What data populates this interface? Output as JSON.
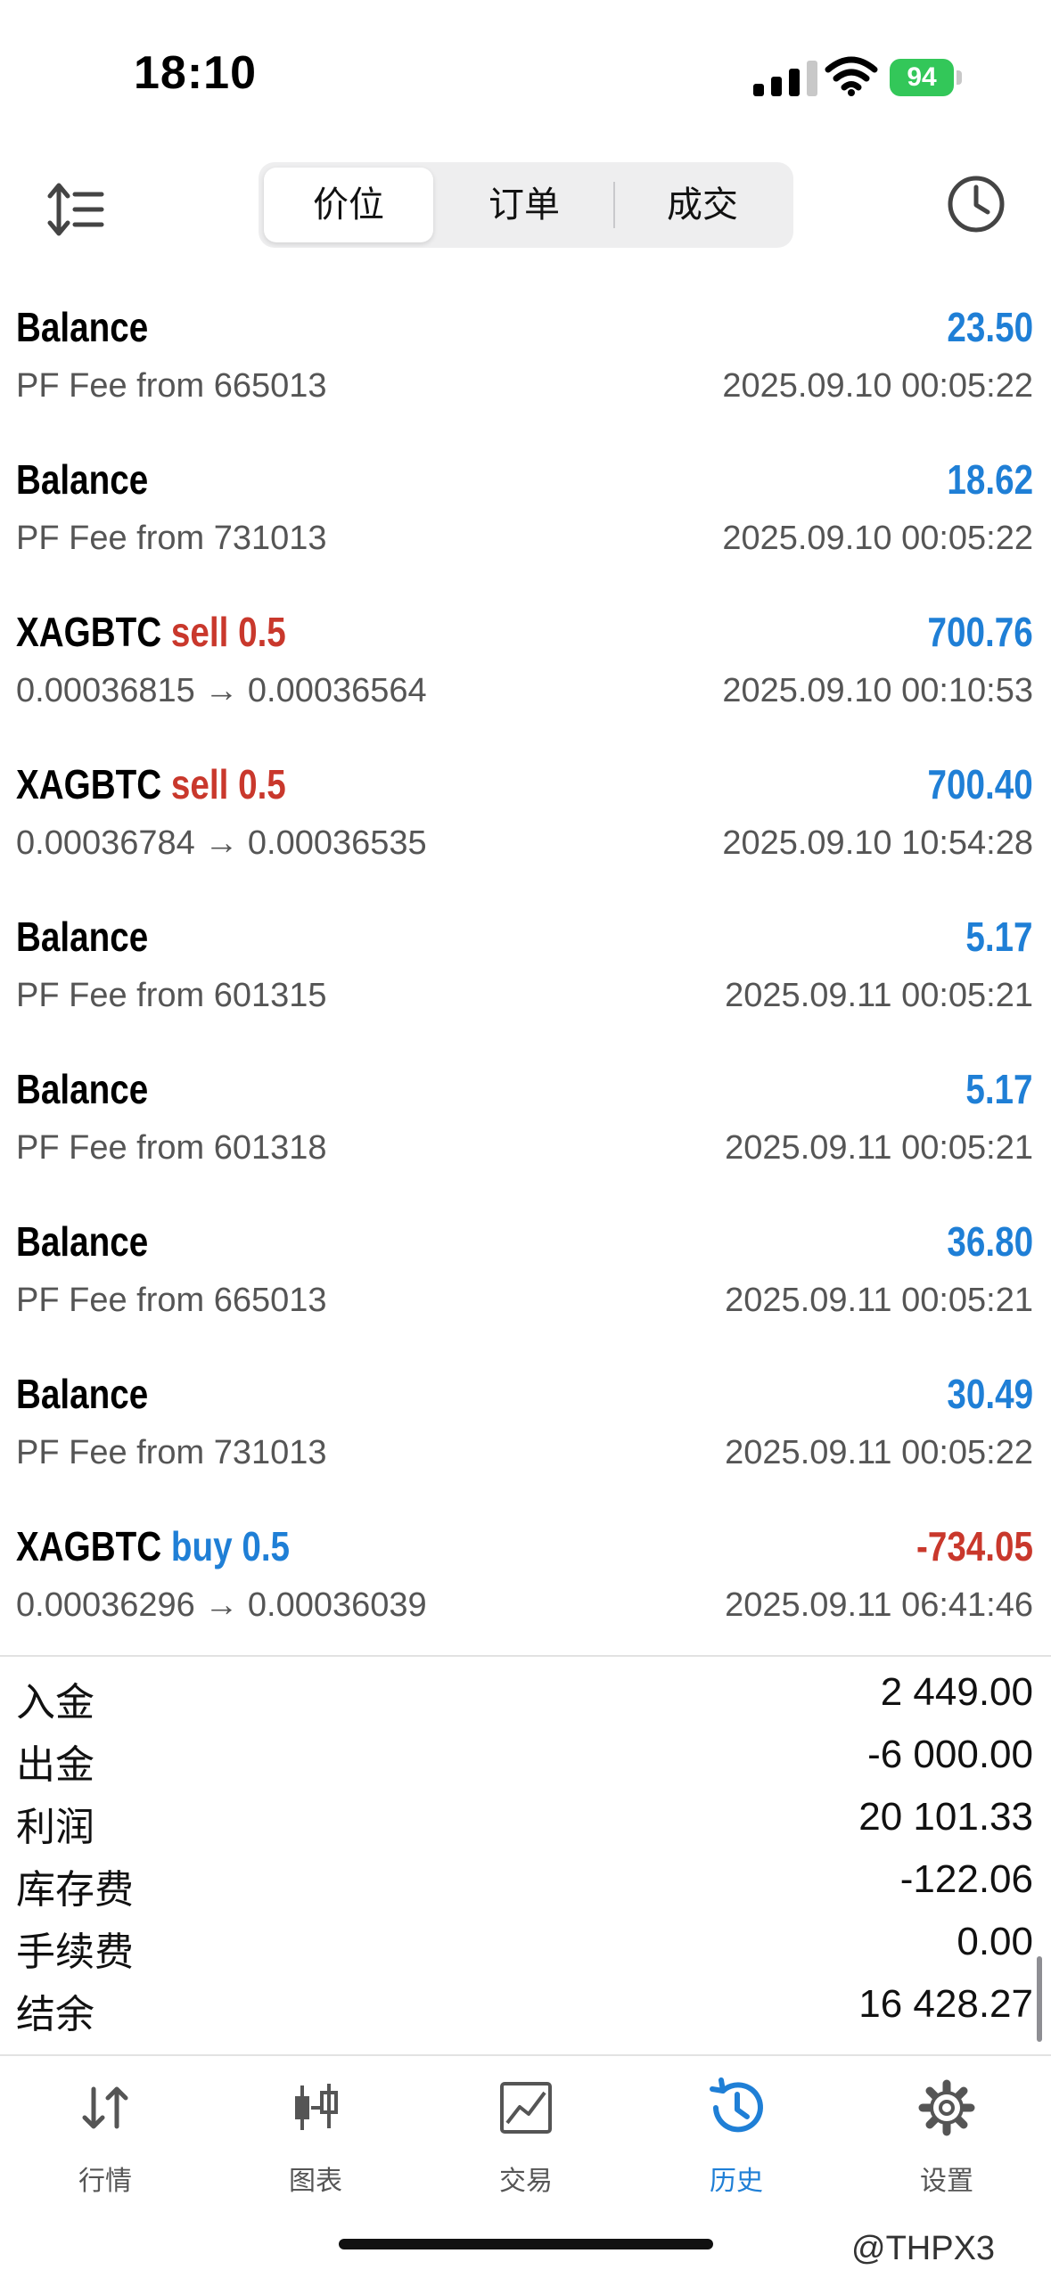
{
  "status_bar": {
    "time": "18:10",
    "battery": "94"
  },
  "segments": [
    "价位",
    "订单",
    "成交"
  ],
  "rows": [
    {
      "symbol": "Balance",
      "side": "",
      "amount": "23.50",
      "negative": false,
      "detail": "PF Fee from 665013",
      "time": "2025.09.10 00:05:22"
    },
    {
      "symbol": "Balance",
      "side": "",
      "amount": "18.62",
      "negative": false,
      "detail": "PF Fee from 731013",
      "time": "2025.09.10 00:05:22"
    },
    {
      "symbol": "XAGBTC",
      "side": "sell 0.5",
      "side_type": "sell",
      "amount": "700.76",
      "negative": false,
      "detail": "0.00036815 → 0.00036564",
      "time": "2025.09.10 00:10:53"
    },
    {
      "symbol": "XAGBTC",
      "side": "sell 0.5",
      "side_type": "sell",
      "amount": "700.40",
      "negative": false,
      "detail": "0.00036784 → 0.00036535",
      "time": "2025.09.10 10:54:28"
    },
    {
      "symbol": "Balance",
      "side": "",
      "amount": "5.17",
      "negative": false,
      "detail": "PF Fee from 601315",
      "time": "2025.09.11 00:05:21"
    },
    {
      "symbol": "Balance",
      "side": "",
      "amount": "5.17",
      "negative": false,
      "detail": "PF Fee from 601318",
      "time": "2025.09.11 00:05:21"
    },
    {
      "symbol": "Balance",
      "side": "",
      "amount": "36.80",
      "negative": false,
      "detail": "PF Fee from 665013",
      "time": "2025.09.11 00:05:21"
    },
    {
      "symbol": "Balance",
      "side": "",
      "amount": "30.49",
      "negative": false,
      "detail": "PF Fee from 731013",
      "time": "2025.09.11 00:05:22"
    },
    {
      "symbol": "XAGBTC",
      "side": "buy 0.5",
      "side_type": "buy",
      "amount": "-734.05",
      "negative": true,
      "detail": "0.00036296 → 0.00036039",
      "time": "2025.09.11 06:41:46"
    }
  ],
  "summary": [
    {
      "label": "入金",
      "value": "2 449.00"
    },
    {
      "label": "出金",
      "value": "-6 000.00"
    },
    {
      "label": "利润",
      "value": "20 101.33"
    },
    {
      "label": "库存费",
      "value": "-122.06"
    },
    {
      "label": "手续费",
      "value": "0.00"
    },
    {
      "label": "结余",
      "value": "16 428.27"
    }
  ],
  "tabs": [
    {
      "label": "行情",
      "icon": "quotes-arrows-icon"
    },
    {
      "label": "图表",
      "icon": "candlestick-chart-icon"
    },
    {
      "label": "交易",
      "icon": "trade-chart-icon"
    },
    {
      "label": "历史",
      "icon": "history-clock-icon",
      "active": true
    },
    {
      "label": "设置",
      "icon": "gear-icon"
    }
  ],
  "watermark": "@THPX3",
  "colors": {
    "positive": "#1f7fd6",
    "negative": "#c9382c",
    "battery": "#33c759"
  }
}
